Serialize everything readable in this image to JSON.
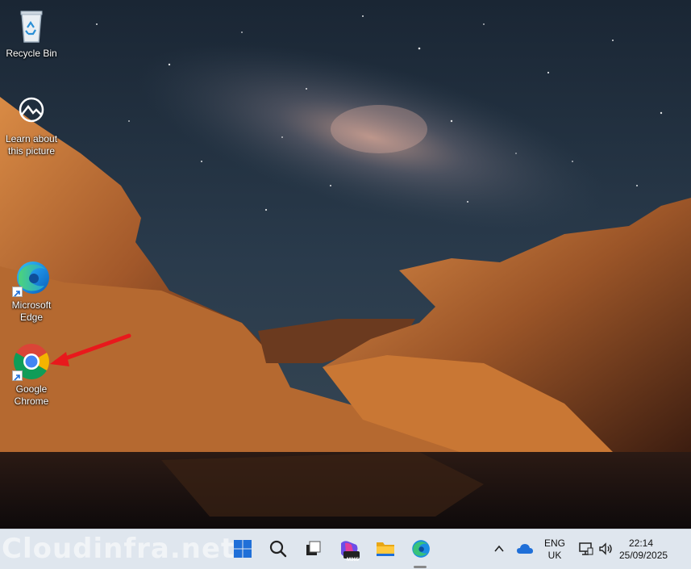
{
  "desktop": {
    "icons": [
      {
        "label": "Recycle Bin",
        "icon": "recycle-bin-icon"
      },
      {
        "label": "Learn about this picture",
        "icon": "learn-about-picture-icon"
      },
      {
        "label": "Microsoft Edge",
        "icon": "edge-icon"
      },
      {
        "label": "Google Chrome",
        "icon": "chrome-icon"
      }
    ]
  },
  "taskbar": {
    "watermark": "Cloudinfra.net",
    "m365_badge": "M365",
    "language": "ENG",
    "region": "UK",
    "time": "22:14",
    "date": "25/09/2025"
  },
  "colors": {
    "arrow": "#e8191c",
    "taskbar_bg": "#dfe6ee",
    "windows_blue": "#1f6fd8"
  }
}
